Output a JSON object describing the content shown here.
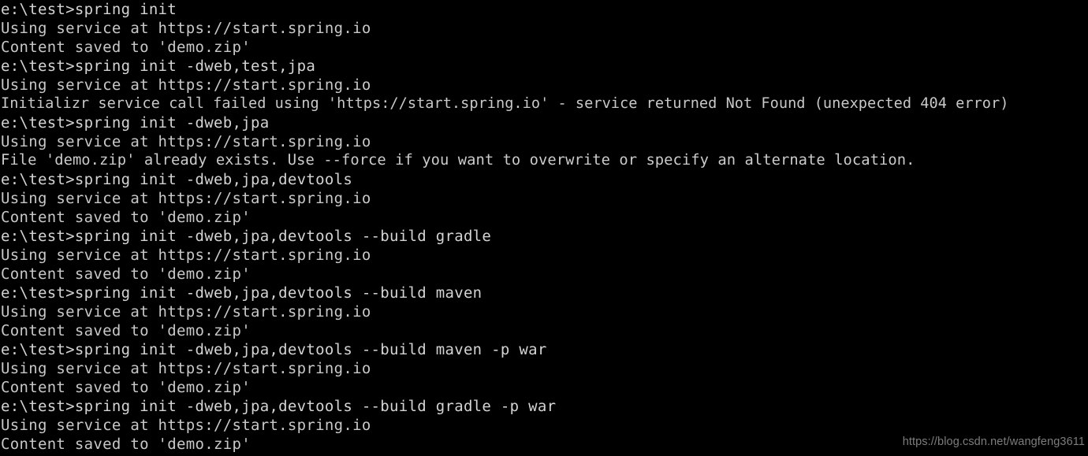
{
  "terminal": {
    "background_color": "#000000",
    "foreground_color": "#cccccc",
    "watermark_color": "#7d7d7d",
    "prompt": "e:\\test>",
    "watermark": "https://blog.csdn.net/wangfeng3611",
    "lines": [
      {
        "kind": "command",
        "text": "e:\\test>spring init"
      },
      {
        "kind": "output",
        "text": "Using service at https://start.spring.io"
      },
      {
        "kind": "output",
        "text": "Content saved to 'demo.zip'"
      },
      {
        "kind": "command",
        "text": "e:\\test>spring init -dweb,test,jpa"
      },
      {
        "kind": "output",
        "text": "Using service at https://start.spring.io"
      },
      {
        "kind": "error",
        "text": "Initializr service call failed using 'https://start.spring.io' - service returned Not Found (unexpected 404 error)"
      },
      {
        "kind": "command",
        "text": "e:\\test>spring init -dweb,jpa"
      },
      {
        "kind": "output",
        "text": "Using service at https://start.spring.io"
      },
      {
        "kind": "wide",
        "text": "File 'demo.zip' already exists. Use --force if you want to overwrite or specify an alternate location."
      },
      {
        "kind": "command",
        "text": "e:\\test>spring init -dweb,jpa,devtools"
      },
      {
        "kind": "output",
        "text": "Using service at https://start.spring.io"
      },
      {
        "kind": "output",
        "text": "Content saved to 'demo.zip'"
      },
      {
        "kind": "command",
        "text": "e:\\test>spring init -dweb,jpa,devtools --build gradle"
      },
      {
        "kind": "output",
        "text": "Using service at https://start.spring.io"
      },
      {
        "kind": "output",
        "text": "Content saved to 'demo.zip'"
      },
      {
        "kind": "command",
        "text": "e:\\test>spring init -dweb,jpa,devtools --build maven"
      },
      {
        "kind": "output",
        "text": "Using service at https://start.spring.io"
      },
      {
        "kind": "output",
        "text": "Content saved to 'demo.zip'"
      },
      {
        "kind": "command",
        "text": "e:\\test>spring init -dweb,jpa,devtools --build maven -p war"
      },
      {
        "kind": "output",
        "text": "Using service at https://start.spring.io"
      },
      {
        "kind": "output",
        "text": "Content saved to 'demo.zip'"
      },
      {
        "kind": "command",
        "text": "e:\\test>spring init -dweb,jpa,devtools --build gradle -p war"
      },
      {
        "kind": "output",
        "text": "Using service at https://start.spring.io"
      },
      {
        "kind": "output",
        "text": "Content saved to 'demo.zip'"
      }
    ]
  }
}
